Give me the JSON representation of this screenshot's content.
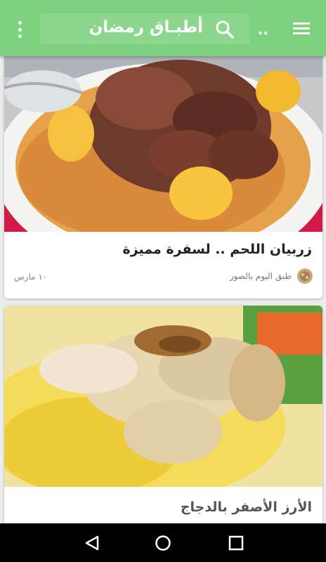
{
  "app": {
    "title": "أطبـاق رمضان",
    "search_hint": "..",
    "accent_color": "#7ed17f"
  },
  "icons": {
    "overflow": "more-vert-icon",
    "search": "search-icon",
    "menu": "hamburger-menu-icon",
    "back": "back-triangle-icon",
    "home": "home-circle-icon",
    "recent": "recent-square-icon"
  },
  "feed": {
    "cards": [
      {
        "title": "زربيان اللحم .. لسفرة مميزة",
        "source": "طبق اليوم بالصور",
        "date": "١٠ مارس",
        "image": "meat-and-rice-dish"
      },
      {
        "title": "الأرز الأصفر بالدجاج",
        "image": "yellow-rice-with-chicken"
      }
    ]
  }
}
